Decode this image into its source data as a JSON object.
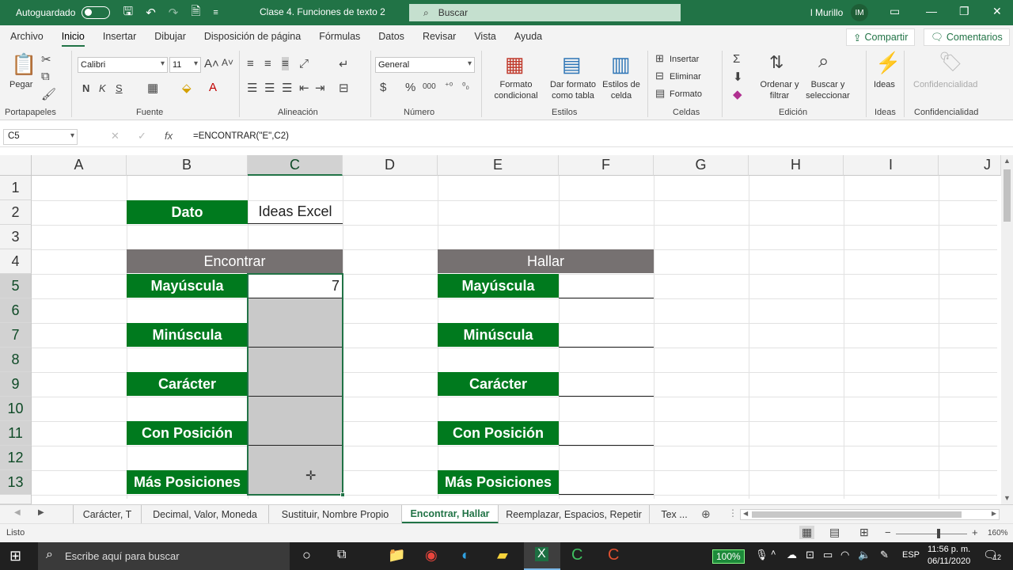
{
  "titlebar": {
    "autosave_label": "Autoguardado",
    "doc_title": "Clase 4. Funciones de texto 2",
    "search_placeholder": "Buscar",
    "user_name": "l Murillo",
    "user_initials": "IM"
  },
  "menu": {
    "items": [
      "Archivo",
      "Inicio",
      "Insertar",
      "Dibujar",
      "Disposición de página",
      "Fórmulas",
      "Datos",
      "Revisar",
      "Vista",
      "Ayuda"
    ],
    "active": "Inicio",
    "share": "Compartir",
    "comments": "Comentarios"
  },
  "ribbon": {
    "clipboard": {
      "paste": "Pegar",
      "label": "Portapapeles"
    },
    "font": {
      "family": "Calibri",
      "size": "11",
      "bold": "N",
      "italic": "K",
      "underline": "S",
      "label": "Fuente"
    },
    "alignment": {
      "label": "Alineación"
    },
    "number": {
      "format": "General",
      "label": "Número"
    },
    "styles": {
      "cond_format_1": "Formato",
      "cond_format_2": "condicional",
      "table_format_1": "Dar formato",
      "table_format_2": "como tabla",
      "cell_styles_1": "Estilos de",
      "cell_styles_2": "celda",
      "label": "Estilos"
    },
    "cells": {
      "insert": "Insertar",
      "delete": "Eliminar",
      "format": "Formato",
      "label": "Celdas"
    },
    "editing": {
      "sort_1": "Ordenar y",
      "sort_2": "filtrar",
      "find_1": "Buscar y",
      "find_2": "seleccionar",
      "label": "Edición"
    },
    "ideas": {
      "button": "Ideas",
      "label": "Ideas"
    },
    "sensitivity": {
      "button": "Confidencialidad",
      "label": "Confidencialidad"
    }
  },
  "formula_bar": {
    "name_box": "C5",
    "formula": "=ENCONTRAR(\"E\",C2)"
  },
  "columns": [
    "A",
    "B",
    "C",
    "D",
    "E",
    "F",
    "G",
    "H",
    "I",
    "J"
  ],
  "rows": [
    "1",
    "2",
    "3",
    "4",
    "5",
    "6",
    "7",
    "8",
    "9",
    "10",
    "11",
    "12",
    "13"
  ],
  "sheet": {
    "dato_label": "Dato",
    "dato_value": "Ideas Excel",
    "left_header": "Encontrar",
    "right_header": "Hallar",
    "labels": [
      "Mayúscula",
      "Minúscula",
      "Carácter",
      "Con Posición",
      "Más Posiciones"
    ],
    "c5_value": "7"
  },
  "sheet_tabs": {
    "tabs": [
      "Carácter, T",
      "Decimal, Valor, Moneda",
      "Sustituir, Nombre Propio",
      "Encontrar, Hallar",
      "Reemplazar, Espacios, Repetir",
      "Tex ..."
    ],
    "active": "Encontrar, Hallar"
  },
  "status": {
    "ready": "Listo",
    "zoom": "160%"
  },
  "taskbar": {
    "search_placeholder": "Escribe aquí para buscar",
    "battery": "100%",
    "lang": "ESP",
    "time": "11:56 p. m.",
    "date": "06/11/2020",
    "notifications": "12"
  }
}
